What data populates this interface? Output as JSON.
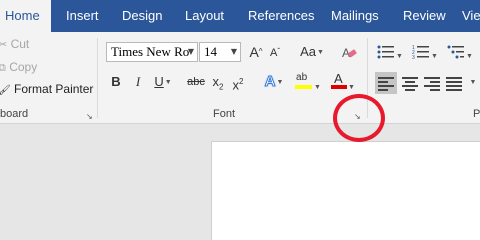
{
  "tabs": [
    {
      "label": "Home",
      "active": true
    },
    {
      "label": "Insert"
    },
    {
      "label": "Design"
    },
    {
      "label": "Layout"
    },
    {
      "label": "References"
    },
    {
      "label": "Mailings"
    },
    {
      "label": "Review"
    },
    {
      "label": "Vie"
    }
  ],
  "clipboard": {
    "cut_label": "Cut",
    "copy_label": "Copy",
    "format_painter_label": "Format Painter",
    "group_label": "board"
  },
  "font": {
    "font_name": "Times New Ro",
    "font_size": "14",
    "grow_label": "A",
    "shrink_label": "A",
    "change_case_label": "Aa",
    "bold_label": "B",
    "italic_label": "I",
    "underline_label": "U",
    "strikethrough_label": "abc",
    "subscript_label": "x",
    "subscript_sub": "2",
    "superscript_label": "x",
    "superscript_sup": "2",
    "text_effects_label": "A",
    "highlight_label": "ab",
    "font_color_label": "A",
    "group_label": "Font",
    "highlight_color": "#ffff00",
    "font_color": "#e00000"
  },
  "paragraph": {
    "group_label": "P"
  },
  "colors": {
    "tab_bar": "#2b579a",
    "ribbon": "#f3f3f3",
    "annotation_circle": "#e8192c"
  }
}
